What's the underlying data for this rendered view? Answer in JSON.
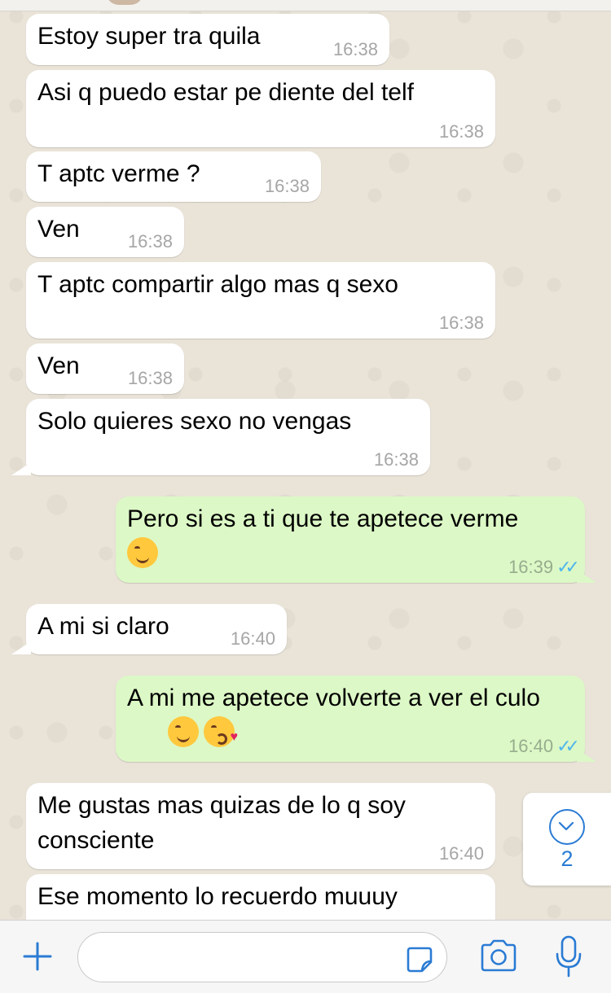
{
  "chat": {
    "messages": [
      {
        "direction": "in",
        "text": "Estoy super tra quila",
        "time": "16:38"
      },
      {
        "direction": "in",
        "text": "Asi q puedo estar pe diente del telf",
        "time": "16:38"
      },
      {
        "direction": "in",
        "text": "T aptc verme ?",
        "time": "16:38"
      },
      {
        "direction": "in",
        "text": "Ven",
        "time": "16:38"
      },
      {
        "direction": "in",
        "text": "T aptc compartir algo mas q sexo",
        "time": "16:38"
      },
      {
        "direction": "in",
        "text": "Ven",
        "time": "16:38"
      },
      {
        "direction": "in",
        "text": "Solo quieres sexo no vengas",
        "time": "16:38"
      },
      {
        "direction": "out",
        "text": "Pero si es a ti que te apetece verme",
        "emojis": [
          "winking-face"
        ],
        "time": "16:39",
        "status": "read"
      },
      {
        "direction": "in",
        "text": "A mi si claro",
        "time": "16:40"
      },
      {
        "direction": "out",
        "text": "A mi me apetece volverte a ver el culo",
        "emojis": [
          "winking-face",
          "face-blowing-kiss"
        ],
        "time": "16:40",
        "status": "read"
      },
      {
        "direction": "in",
        "text": "Me gustas mas quizas de lo q soy consciente",
        "time": "16:40"
      },
      {
        "direction": "in",
        "text": "Ese momento lo recuerdo muuuy",
        "time": ""
      }
    ],
    "colors": {
      "incoming": "#ffffff",
      "outgoing": "#dcf8c6",
      "read_ticks": "#4fb6ec",
      "accent": "#2a7bd4"
    }
  },
  "scroll_button": {
    "icon": "chevron-down-icon",
    "unread_count": "2"
  },
  "composer": {
    "input_value": "",
    "icons": [
      "plus-icon",
      "sticker-icon",
      "camera-icon",
      "microphone-icon"
    ]
  }
}
